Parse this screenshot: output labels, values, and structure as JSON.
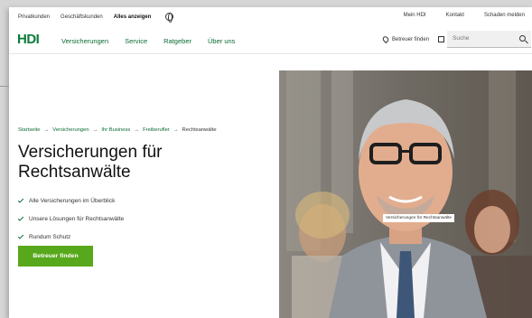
{
  "topbar": {
    "left_items": [
      "Privatkunden",
      "Geschäftskunden",
      "Alles anzeigen"
    ],
    "right_items": [
      "Mein HDI",
      "Kontakt",
      "Schaden melden"
    ]
  },
  "nav": {
    "logo": "HDI",
    "menu": [
      "Versicherungen",
      "Service",
      "Ratgeber",
      "Über uns"
    ],
    "finder_label": "Betreuer finden",
    "search_placeholder": "Suche"
  },
  "breadcrumb": [
    "Startseite",
    "Versicherungen",
    "Ihr Business",
    "Freiberufler",
    "Rechtsanwälte"
  ],
  "title_line1": "Versicherungen für",
  "title_line2": "Rechtsanwälte",
  "features": [
    "Alle Versicherungen im Überblick",
    "Unsere Lösungen für Rechtsanwälte",
    "Rundum Schutz"
  ],
  "cta_label": "Betreuer finden",
  "image_tooltip": "Versicherungen für Rechtsanwälte",
  "icons": {
    "globe": "globe-icon",
    "finder": "location-pin-icon",
    "external": "external-link-icon",
    "search": "search-icon",
    "check": "check-icon"
  },
  "colors": {
    "brand_green": "#0a7c3a",
    "cta_green": "#58a81c"
  }
}
